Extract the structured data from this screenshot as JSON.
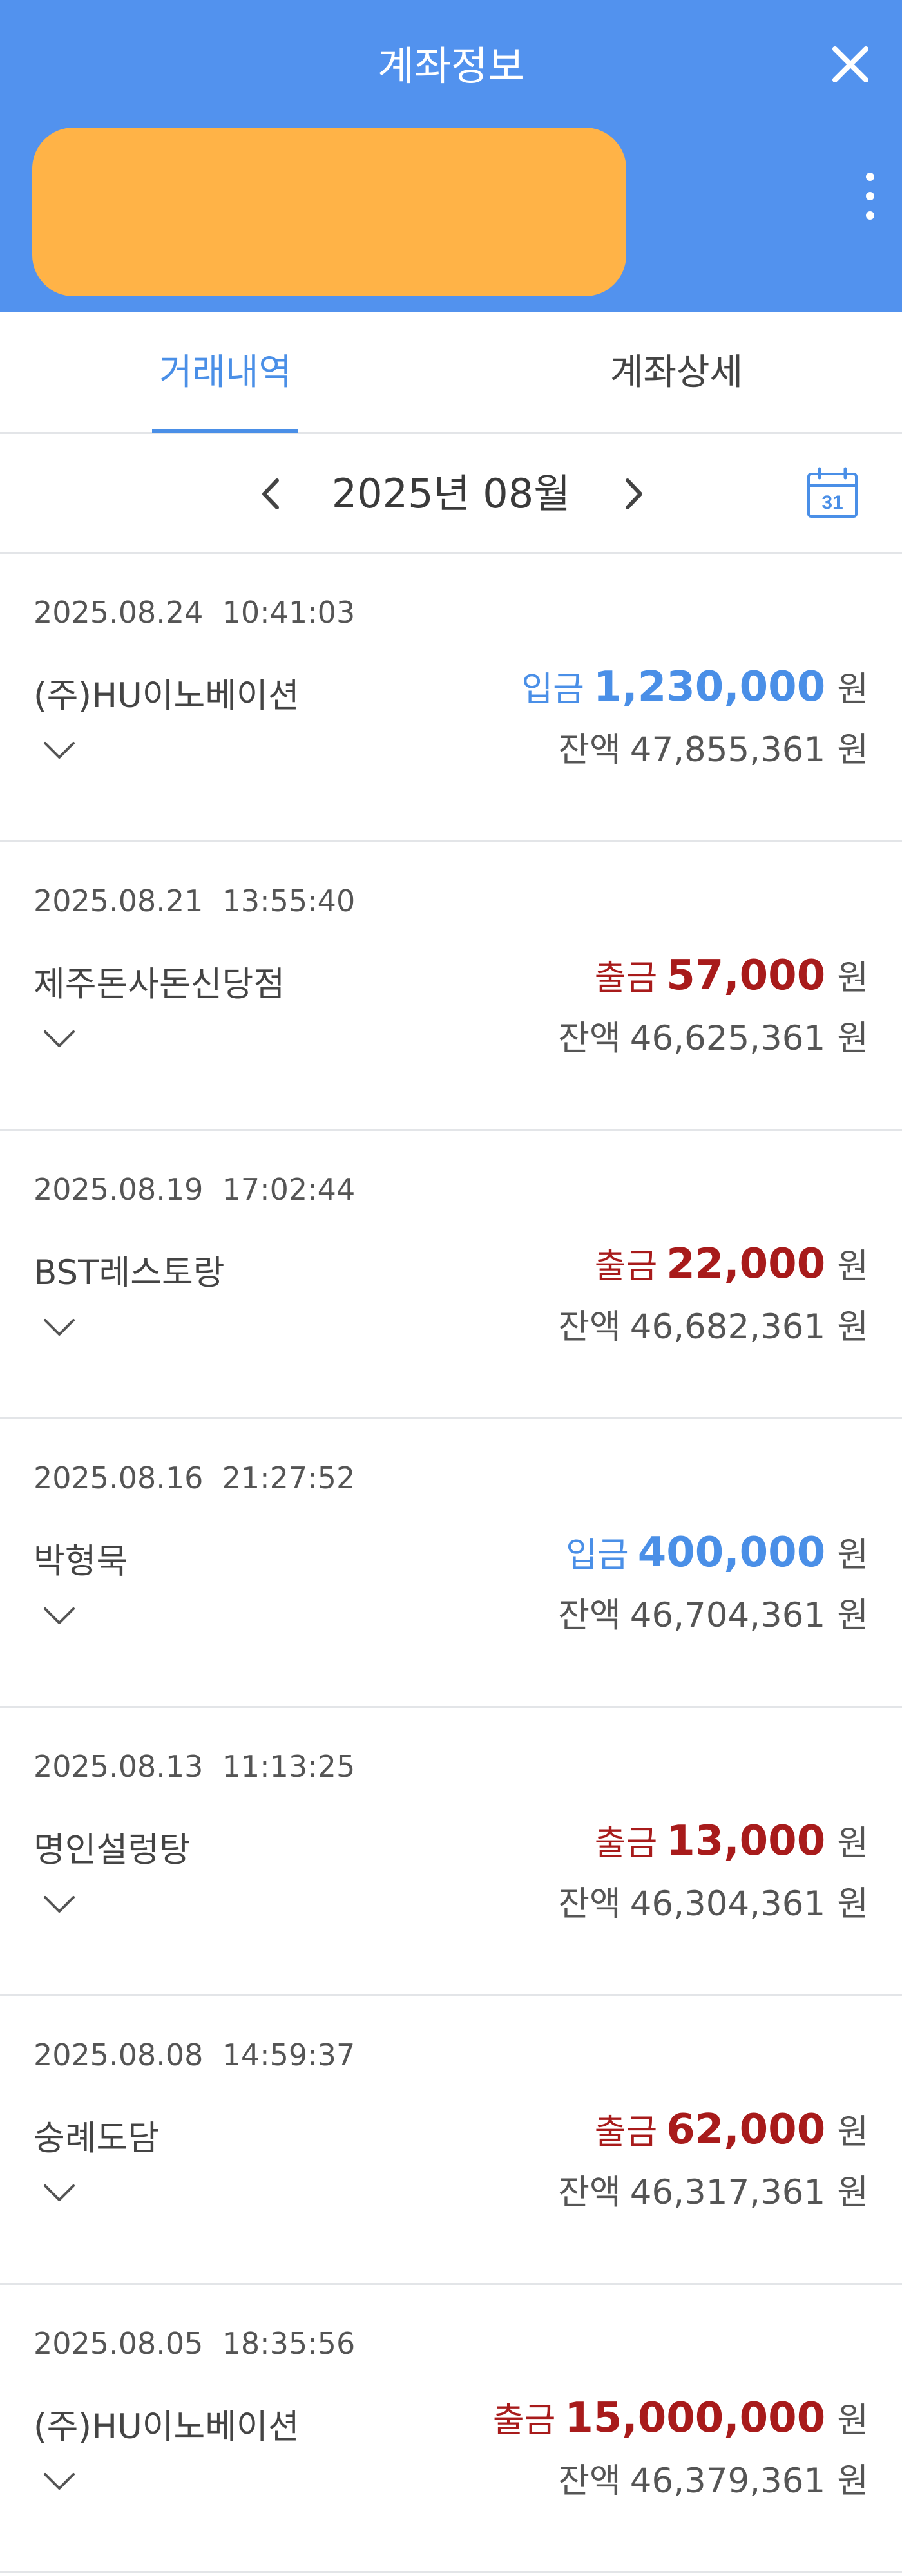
{
  "colors": {
    "header": "#5292EE",
    "card": "#FFB347",
    "deposit": "#4A8FE7",
    "withdraw": "#A81B1B"
  },
  "header": {
    "title": "계좌정보",
    "close_icon": "close-icon",
    "more_icon": "more-vertical-icon"
  },
  "tabs": [
    {
      "label": "거래내역",
      "active": true
    },
    {
      "label": "계좌상세",
      "active": false
    }
  ],
  "month_selector": {
    "label": "2025년 08월",
    "prev_icon": "chevron-left-icon",
    "next_icon": "chevron-right-icon",
    "calendar_icon": "calendar-icon",
    "calendar_day": "31"
  },
  "transactions": [
    {
      "datetime": "2025.08.24  10:41:03",
      "merchant": "(주)HU이노베이션",
      "type": "입금",
      "kind": "deposit",
      "amount": "1,230,000",
      "unit": "원",
      "balance_label": "잔액",
      "balance": "47,855,361",
      "balance_unit": "원"
    },
    {
      "datetime": "2025.08.21  13:55:40",
      "merchant": "제주돈사돈신당점",
      "type": "출금",
      "kind": "withdraw",
      "amount": "57,000",
      "unit": "원",
      "balance_label": "잔액",
      "balance": "46,625,361",
      "balance_unit": "원"
    },
    {
      "datetime": "2025.08.19  17:02:44",
      "merchant": "BST레스토랑",
      "type": "출금",
      "kind": "withdraw",
      "amount": "22,000",
      "unit": "원",
      "balance_label": "잔액",
      "balance": "46,682,361",
      "balance_unit": "원"
    },
    {
      "datetime": "2025.08.16  21:27:52",
      "merchant": "박형묵",
      "type": "입금",
      "kind": "deposit",
      "amount": "400,000",
      "unit": "원",
      "balance_label": "잔액",
      "balance": "46,704,361",
      "balance_unit": "원"
    },
    {
      "datetime": "2025.08.13  11:13:25",
      "merchant": "명인설렁탕",
      "type": "출금",
      "kind": "withdraw",
      "amount": "13,000",
      "unit": "원",
      "balance_label": "잔액",
      "balance": "46,304,361",
      "balance_unit": "원"
    },
    {
      "datetime": "2025.08.08  14:59:37",
      "merchant": "숭례도담",
      "type": "출금",
      "kind": "withdraw",
      "amount": "62,000",
      "unit": "원",
      "balance_label": "잔액",
      "balance": "46,317,361",
      "balance_unit": "원"
    },
    {
      "datetime": "2025.08.05  18:35:56",
      "merchant": "(주)HU이노베이션",
      "type": "출금",
      "kind": "withdraw",
      "amount": "15,000,000",
      "unit": "원",
      "balance_label": "잔액",
      "balance": "46,379,361",
      "balance_unit": "원"
    }
  ]
}
